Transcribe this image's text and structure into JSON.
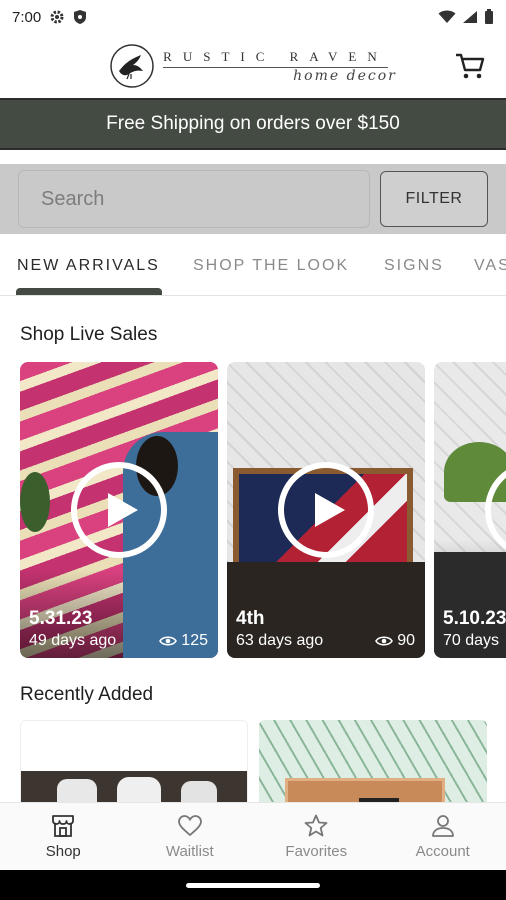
{
  "status_bar": {
    "time": "7:00"
  },
  "brand": {
    "line1": "RUSTIC RAVEN",
    "line2": "home decor"
  },
  "promo": {
    "text": "Free Shipping on orders over $150"
  },
  "search": {
    "placeholder": "Search",
    "value": "",
    "filter_label": "FILTER"
  },
  "tabs": [
    {
      "label": "NEW ARRIVALS",
      "active": true
    },
    {
      "label": "SHOP THE LOOK",
      "active": false
    },
    {
      "label": "SIGNS",
      "active": false
    },
    {
      "label": "VAS",
      "active": false
    }
  ],
  "live_sales": {
    "title": "Shop Live Sales",
    "cards": [
      {
        "date": "5.31.23",
        "ago": "49 days ago",
        "views": "125"
      },
      {
        "date": "4th",
        "ago": "63 days ago",
        "views": "90"
      },
      {
        "date": "5.10.23",
        "ago": "70 days",
        "views": ""
      }
    ]
  },
  "recently_added": {
    "title": "Recently Added"
  },
  "bottom_nav": [
    {
      "label": "Shop",
      "icon": "storefront-icon",
      "active": true
    },
    {
      "label": "Waitlist",
      "icon": "heart-icon",
      "active": false
    },
    {
      "label": "Favorites",
      "icon": "star-icon",
      "active": false
    },
    {
      "label": "Account",
      "icon": "person-icon",
      "active": false
    }
  ],
  "colors": {
    "accent": "#434b42",
    "search_bg": "#c9c9c9"
  }
}
